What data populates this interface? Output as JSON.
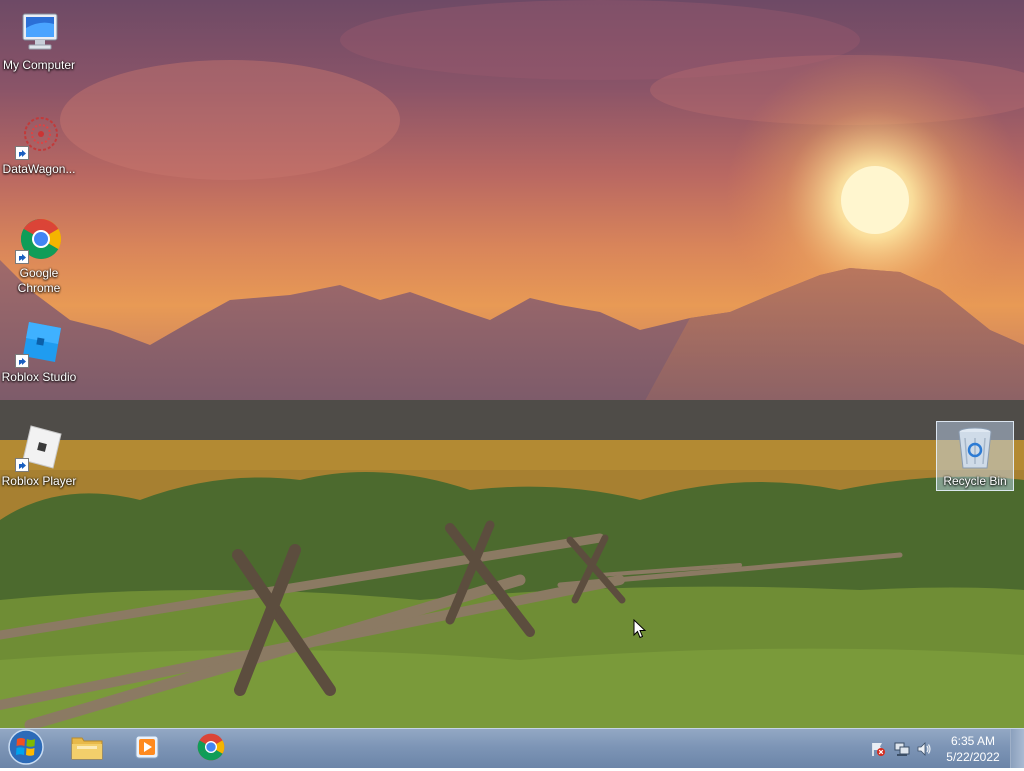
{
  "desktop": {
    "icons": [
      {
        "label": "My Computer",
        "icon": "computer-icon"
      },
      {
        "label": "DataWagon...",
        "icon": "datawagon-icon"
      },
      {
        "label": "Google Chrome",
        "icon": "chrome-icon"
      },
      {
        "label": "Roblox Studio",
        "icon": "roblox-studio-icon"
      },
      {
        "label": "Roblox Player",
        "icon": "roblox-player-icon"
      }
    ],
    "recycle_bin": {
      "label": "Recycle Bin",
      "icon": "recycle-bin-icon",
      "selected": true
    }
  },
  "taskbar": {
    "start": {
      "icon": "windows-logo-icon"
    },
    "pinned": [
      {
        "name": "File Explorer",
        "icon": "folder-icon"
      },
      {
        "name": "Windows Media Player",
        "icon": "media-player-icon"
      },
      {
        "name": "Google Chrome",
        "icon": "chrome-icon"
      }
    ],
    "tray": {
      "icons": [
        "action-center-flag-icon",
        "network-icon",
        "volume-icon"
      ],
      "time": "6:35 AM",
      "date": "5/22/2022"
    }
  },
  "colors": {
    "taskbar": "#7d95b6",
    "sky_top": "#6e4a66",
    "sun": "#fff3c0",
    "selection": "#c8e1ff"
  }
}
